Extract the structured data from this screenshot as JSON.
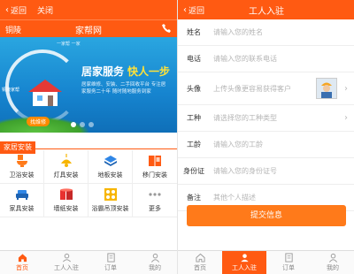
{
  "left": {
    "topbar": {
      "back_label": "返回",
      "close_label": "关闭"
    },
    "cityrow": {
      "city": "铜陵",
      "site_name": "家帮网"
    },
    "banner": {
      "tagline": "一家帮 一家",
      "headline": "居家服务",
      "headline_highlight": "快人一步",
      "subtext": "居家维修、安装、二手回收平台 专注居家服务二十年 随时随地服务到家",
      "small_label": "铜陵家帮",
      "badge": "找维修",
      "slides_total": 3,
      "slide_active": 1
    },
    "section_tag": "家居安装",
    "services": [
      {
        "label": "卫浴安装",
        "icon": "toilet-icon",
        "color": "#ff7a1a"
      },
      {
        "label": "灯具安装",
        "icon": "lamp-icon",
        "color": "#f7b500"
      },
      {
        "label": "地板安装",
        "icon": "floor-icon",
        "color": "#2f86e6"
      },
      {
        "label": "移门安装",
        "icon": "sliding-door-icon",
        "color": "#ff5a12"
      },
      {
        "label": "家具安装",
        "icon": "sofa-icon",
        "color": "#2f86e6"
      },
      {
        "label": "墙纸安装",
        "icon": "wallpaper-icon",
        "color": "#e8312f"
      },
      {
        "label": "浴霸吊顶安装",
        "icon": "bath-heater-icon",
        "color": "#f7b500"
      },
      {
        "label": "更多",
        "icon": "more-icon",
        "color": "#999999"
      }
    ],
    "tabs": [
      {
        "label": "首页",
        "icon": "home-icon"
      },
      {
        "label": "工人入驻",
        "icon": "worker-icon"
      },
      {
        "label": "订单",
        "icon": "order-icon"
      },
      {
        "label": "我的",
        "icon": "user-icon"
      }
    ]
  },
  "right": {
    "topbar": {
      "back_label": "返回",
      "title": "工人入驻"
    },
    "form": [
      {
        "label": "姓名",
        "placeholder": "请输入您的姓名"
      },
      {
        "label": "电话",
        "placeholder": "请输入您的联系电话"
      },
      {
        "label": "头像",
        "placeholder": "上传头像更容易获得客户"
      },
      {
        "label": "工种",
        "placeholder": "请选择您的工种类型"
      },
      {
        "label": "工龄",
        "placeholder": "请输入您的工龄"
      },
      {
        "label": "身份证",
        "placeholder": "请输入您的身份证号"
      },
      {
        "label": "备注",
        "placeholder": "其他个人描述"
      }
    ],
    "submit_label": "提交信息",
    "tabs": [
      {
        "label": "首页",
        "icon": "home-icon"
      },
      {
        "label": "工人入驻",
        "icon": "worker-icon"
      },
      {
        "label": "订单",
        "icon": "order-icon"
      },
      {
        "label": "我的",
        "icon": "user-icon"
      }
    ]
  },
  "colors": {
    "accent": "#ff5a12",
    "submit": "#ff7a1a",
    "banner": "#1684cf"
  }
}
